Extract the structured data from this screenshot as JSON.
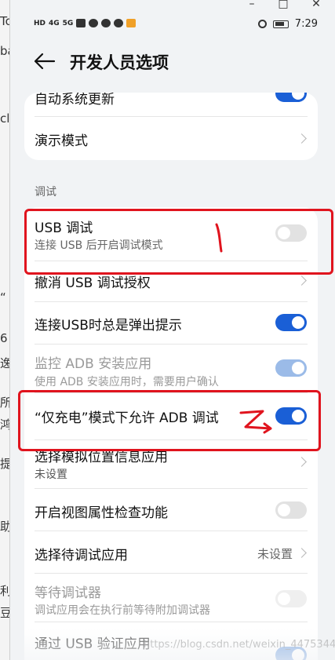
{
  "window_controls": {
    "minimize": "–",
    "maximize": "□",
    "close": "✕"
  },
  "background_glyphs": [
    "To",
    "ba",
    "cl",
    "“",
    "6",
    "逸",
    "所",
    "鸿",
    "提",
    "助",
    "利",
    "豆"
  ],
  "status_bar": {
    "left_chips": [
      "HD",
      "4G",
      "5G"
    ],
    "time": "7:29"
  },
  "header": {
    "title": "开发人员选项"
  },
  "top_card": {
    "partial_title": "自动系统更新",
    "demo_mode": "演示模式"
  },
  "section": {
    "label": "调试"
  },
  "debug_items": [
    {
      "title": "USB 调试",
      "sub": "连接 USB 后开启调试模式",
      "control": "toggle",
      "state": "off",
      "dim": false
    },
    {
      "title": "撤消 USB 调试授权",
      "sub": "",
      "control": "chevron",
      "dim": false
    },
    {
      "title": "连接USB时总是弹出提示",
      "sub": "",
      "control": "toggle",
      "state": "on",
      "dim": false
    },
    {
      "title": "监控 ADB 安装应用",
      "sub": "使用 ADB 安装应用时，需要用户确认",
      "control": "toggle",
      "state": "on",
      "dim": true
    },
    {
      "title": "“仅充电”模式下允许 ADB 调试",
      "sub": "",
      "control": "toggle",
      "state": "on",
      "dim": false
    },
    {
      "title": "选择模拟位置信息应用",
      "sub": "未设置",
      "control": "chevron",
      "dim": false
    },
    {
      "title": "开启视图属性检查功能",
      "sub": "",
      "control": "toggle",
      "state": "off",
      "dim": false
    },
    {
      "title": "选择待调试应用",
      "sub": "",
      "control": "chevron",
      "value": "未设置",
      "dim": false
    },
    {
      "title": "等待调试器",
      "sub": "调试应用会在执行前等待附加调试器",
      "control": "toggle",
      "state": "off",
      "dim": true
    },
    {
      "title": "通过 USB 验证应用",
      "sub": "",
      "control": "toggle",
      "state": "on",
      "dim": false
    }
  ],
  "watermark": "https://blog.csdn.net/weixin_44753443",
  "colors": {
    "accent": "#1a5fd6",
    "annotation": "#e0141e",
    "card": "#ffffff",
    "background": "#f1f3f5"
  }
}
